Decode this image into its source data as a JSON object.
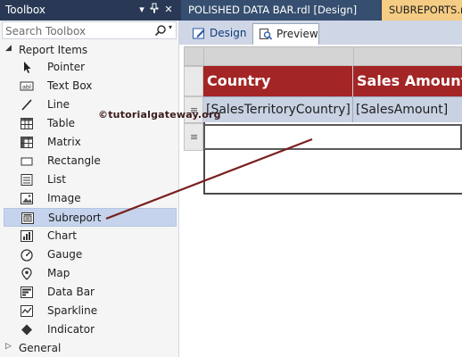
{
  "toolbox": {
    "title": "Toolbox",
    "search_placeholder": "Search Toolbox",
    "group_label": "Report Items",
    "items": [
      {
        "label": "Pointer",
        "icon": "pointer-icon"
      },
      {
        "label": "Text Box",
        "icon": "textbox-icon"
      },
      {
        "label": "Line",
        "icon": "line-icon"
      },
      {
        "label": "Table",
        "icon": "table-icon"
      },
      {
        "label": "Matrix",
        "icon": "matrix-icon"
      },
      {
        "label": "Rectangle",
        "icon": "rectangle-icon"
      },
      {
        "label": "List",
        "icon": "list-icon"
      },
      {
        "label": "Image",
        "icon": "image-icon"
      },
      {
        "label": "Subreport",
        "icon": "subreport-icon",
        "selected": true
      },
      {
        "label": "Chart",
        "icon": "chart-icon"
      },
      {
        "label": "Gauge",
        "icon": "gauge-icon"
      },
      {
        "label": "Map",
        "icon": "map-icon"
      },
      {
        "label": "Data Bar",
        "icon": "databar-icon"
      },
      {
        "label": "Sparkline",
        "icon": "sparkline-icon"
      },
      {
        "label": "Indicator",
        "icon": "indicator-icon"
      }
    ],
    "general_label": "General"
  },
  "doc_tabs": [
    {
      "label": "POLISHED DATA BAR.rdl [Design]"
    },
    {
      "label": "SUBREPORTS.rd"
    }
  ],
  "view_tabs": {
    "design": "Design",
    "preview": "Preview"
  },
  "table": {
    "headers": [
      "Country",
      "Sales Amount"
    ],
    "row": [
      "[SalesTerritoryCountry]",
      "[SalesAmount]"
    ]
  },
  "watermark": "©tutorialgateway.org",
  "colors": {
    "header_bg": "#a42525",
    "data_bg": "#c9d2e3",
    "chrome": "#293955",
    "active_tab": "#f5cc84",
    "drag_line": "#7a1f1f"
  }
}
